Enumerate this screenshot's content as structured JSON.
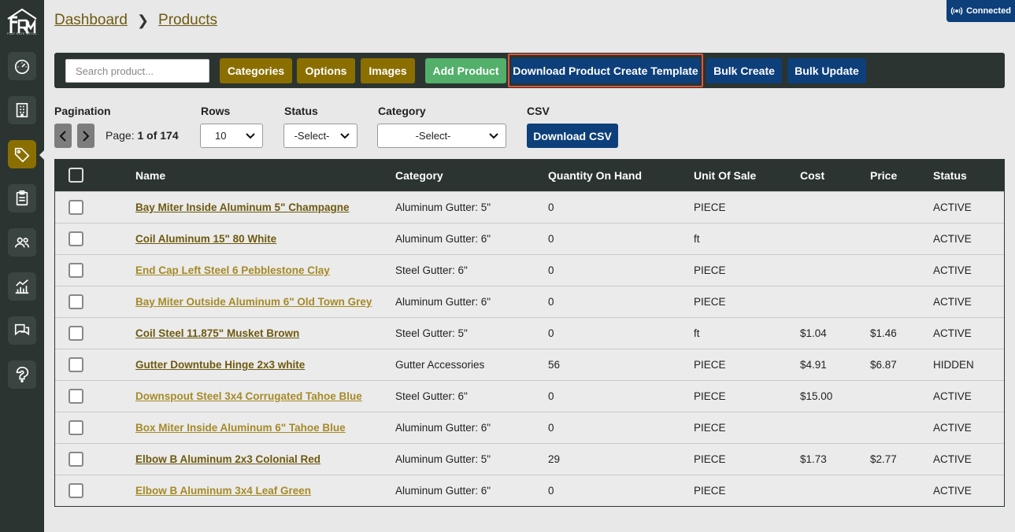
{
  "logo": {
    "text": "FLAT RATE METAL"
  },
  "status_badge": {
    "label": "Connected"
  },
  "breadcrumb": {
    "root": "Dashboard",
    "current": "Products"
  },
  "toolbar": {
    "search_placeholder": "Search product...",
    "categories": "Categories",
    "options": "Options",
    "images": "Images",
    "add_product": "Add Product",
    "download_template": "Download Product Create Template",
    "bulk_create": "Bulk Create",
    "bulk_update": "Bulk Update"
  },
  "filters": {
    "pagination_label": "Pagination",
    "page_prefix": "Page:",
    "page_value": "1 of 174",
    "rows_label": "Rows",
    "rows_value": "10",
    "status_label": "Status",
    "status_value": "-Select-",
    "category_label": "Category",
    "category_value": "-Select-",
    "csv_label": "CSV",
    "csv_button": "Download CSV"
  },
  "table": {
    "headers": {
      "name": "Name",
      "category": "Category",
      "qty": "Quantity On Hand",
      "unit": "Unit Of Sale",
      "cost": "Cost",
      "price": "Price",
      "status": "Status"
    },
    "rows": [
      {
        "name": "Bay Miter Inside Aluminum 5\" Champagne",
        "category": "Aluminum Gutter: 5\"",
        "qty": "0",
        "unit": "PIECE",
        "cost": "",
        "price": "",
        "status": "ACTIVE"
      },
      {
        "name": "Coil Aluminum 15\" 80 White",
        "category": "Aluminum Gutter: 6\"",
        "qty": "0",
        "unit": "ft",
        "cost": "",
        "price": "",
        "status": "ACTIVE"
      },
      {
        "name": "End Cap Left Steel 6 Pebblestone Clay",
        "category": "Steel Gutter: 6\"",
        "qty": "0",
        "unit": "PIECE",
        "cost": "",
        "price": "",
        "status": "ACTIVE"
      },
      {
        "name": "Bay Miter Outside Aluminum 6\" Old Town Grey",
        "category": "Aluminum Gutter: 6\"",
        "qty": "0",
        "unit": "PIECE",
        "cost": "",
        "price": "",
        "status": "ACTIVE"
      },
      {
        "name": "Coil Steel 11.875\" Musket Brown",
        "category": "Steel Gutter: 5\"",
        "qty": "0",
        "unit": "ft",
        "cost": "$1.04",
        "price": "$1.46",
        "status": "ACTIVE"
      },
      {
        "name": "Gutter Downtube Hinge 2x3 white",
        "category": "Gutter Accessories",
        "qty": "56",
        "unit": "PIECE",
        "cost": "$4.91",
        "price": "$6.87",
        "status": "HIDDEN"
      },
      {
        "name": "Downspout Steel 3x4 Corrugated Tahoe Blue",
        "category": "Steel Gutter: 6\"",
        "qty": "0",
        "unit": "PIECE",
        "cost": "$15.00",
        "price": "",
        "status": "ACTIVE"
      },
      {
        "name": "Box Miter Inside Aluminum 6\" Tahoe Blue",
        "category": "Aluminum Gutter: 6\"",
        "qty": "0",
        "unit": "PIECE",
        "cost": "",
        "price": "",
        "status": "ACTIVE"
      },
      {
        "name": "Elbow B Aluminum 2x3 Colonial Red",
        "category": "Aluminum Gutter: 5\"",
        "qty": "29",
        "unit": "PIECE",
        "cost": "$1.73",
        "price": "$2.77",
        "status": "ACTIVE"
      },
      {
        "name": "Elbow B Aluminum 3x4 Leaf Green",
        "category": "Aluminum Gutter: 6\"",
        "qty": "0",
        "unit": "PIECE",
        "cost": "",
        "price": "",
        "status": "ACTIVE"
      }
    ]
  }
}
